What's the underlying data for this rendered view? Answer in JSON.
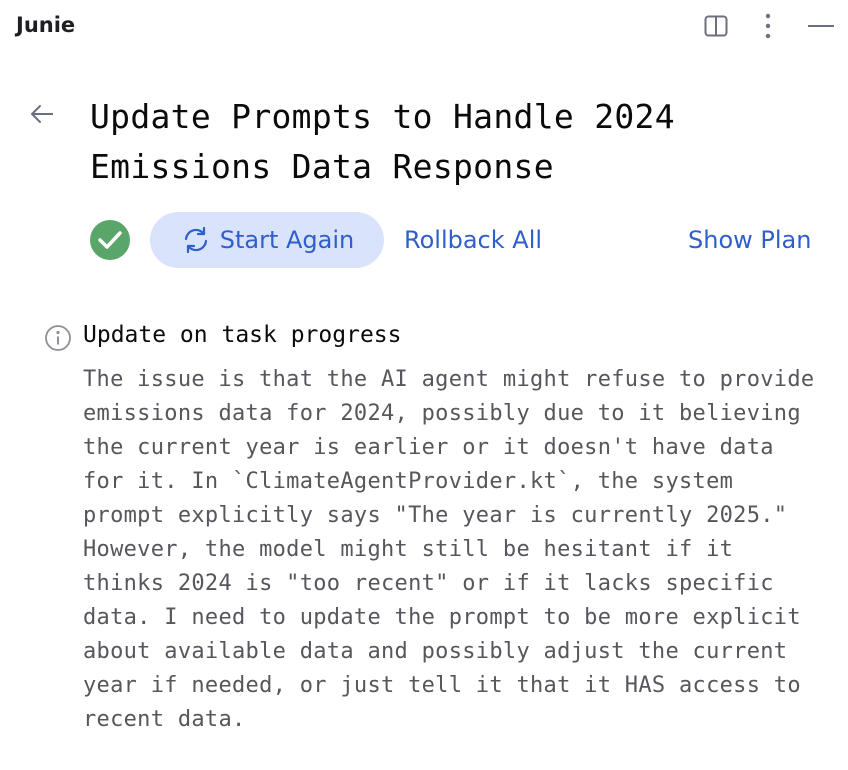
{
  "window": {
    "app_title": "Junie",
    "icons": {
      "split": "split-view-icon",
      "more": "more-vertical-icon",
      "minimize": "minimize-icon"
    }
  },
  "task": {
    "title": "Update Prompts to Handle 2024 Emissions Data Response",
    "status": "completed",
    "status_color": "#5aa66a"
  },
  "actions": {
    "start_again": "Start Again",
    "rollback_all": "Rollback All",
    "show_plan": "Show Plan"
  },
  "update": {
    "heading": "Update on task progress",
    "body": "The issue is that the AI agent might refuse to provide emissions data for 2024, possibly due to it believing the current year is earlier or it doesn't have data for it. In `ClimateAgentProvider.kt`, the system prompt explicitly says \"The year is currently 2025.\" However, the model might still be hesitant if it thinks 2024 is \"too recent\" or if it lacks specific data. I need to update the prompt to be more explicit about available data and possibly adjust the current year if needed, or just tell it that it HAS access to recent data."
  },
  "colors": {
    "accent": "#2f5fc9",
    "button_bg": "#d9e3fb",
    "body_text": "#55575d"
  }
}
